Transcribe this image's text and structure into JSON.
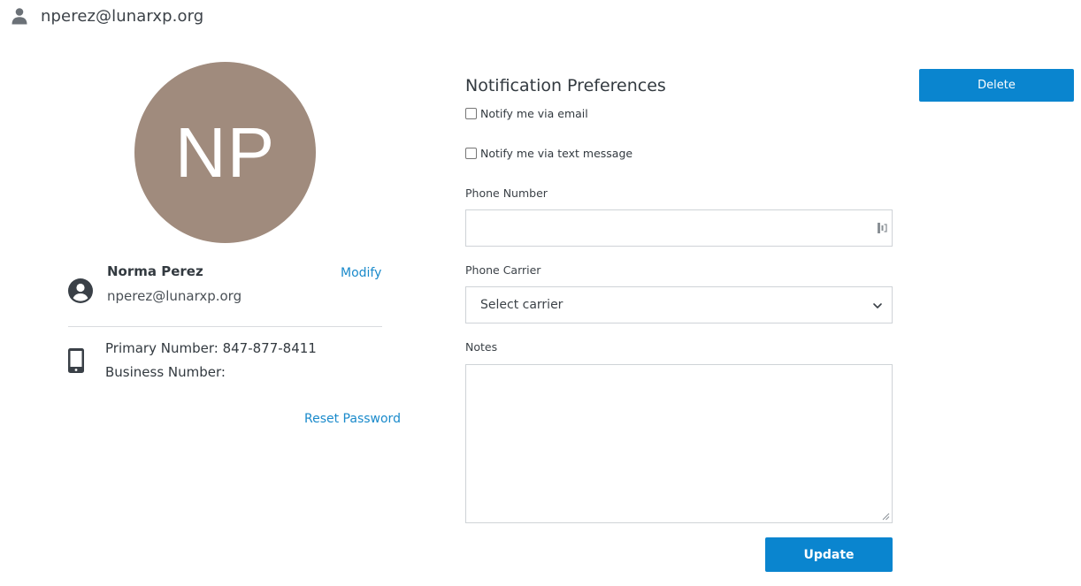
{
  "header": {
    "user_email": "nperez@lunarxp.org",
    "icon": "user-icon"
  },
  "profile": {
    "initials": "NP",
    "avatar_color": "#a08b7d",
    "name": "Norma Perez",
    "email": "nperez@lunarxp.org",
    "modify_label": "Modify",
    "primary_number_label": "Primary Number:",
    "primary_number": "847-877-8411",
    "business_number_label": "Business Number:",
    "business_number": "",
    "reset_password_label": "Reset Password"
  },
  "notifications": {
    "title": "Notification Preferences",
    "email_option": {
      "label": "Notify me via email",
      "checked": false
    },
    "text_option": {
      "label": "Notify me via text message",
      "checked": false
    },
    "phone_number_label": "Phone Number",
    "phone_number_value": "",
    "carrier_label": "Phone Carrier",
    "carrier_selected": "Select carrier",
    "notes_label": "Notes",
    "notes_value": ""
  },
  "actions": {
    "delete_label": "Delete",
    "update_label": "Update",
    "accent_color": "#0a85cf",
    "link_color": "#1a8acb"
  }
}
